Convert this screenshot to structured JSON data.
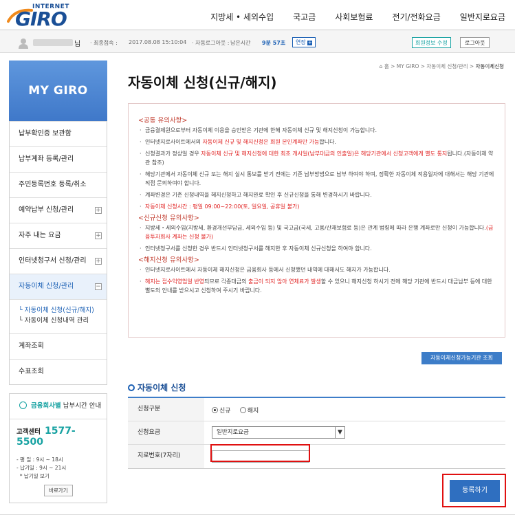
{
  "header": {
    "logo_small": "INTERNET",
    "logo_big": "GIRO",
    "nav": [
      "지방세 • 세외수입",
      "국고금",
      "사회보험료",
      "전기/전화요금",
      "일반지로요금"
    ]
  },
  "userbar": {
    "name_suffix": "님",
    "last_login_label": "· 최종접속 :",
    "last_login_value": "2017.08.08 15:10:04",
    "auto_logout_label": "· 자동로그아웃 :",
    "remaining_label": "남은시간",
    "remaining_value": "9분 57초",
    "extend_label": "연장",
    "edit_info_label": "회원정보 수정",
    "logout_label": "로그아웃"
  },
  "sidebar": {
    "title": "MY GIRO",
    "items": [
      {
        "label": "납부확인증 보관함",
        "plus": false
      },
      {
        "label": "납부계좌 등록/관리",
        "plus": false
      },
      {
        "label": "주민등록번호 등록/취소",
        "plus": false
      },
      {
        "label": "예약납부 신청/관리",
        "plus": true
      },
      {
        "label": "자주 내는 요금",
        "plus": true
      },
      {
        "label": "인터넷청구서 신청/관리",
        "plus": true
      },
      {
        "label": "자동이체 신청/관리",
        "plus": true,
        "active": true
      }
    ],
    "submenu": [
      "└ 자동이체 신청(신규/해지)",
      "└ 자동이체 신청내역 관리"
    ],
    "items_after": [
      "계좌조회",
      "수표조회"
    ],
    "help": {
      "top_teal": "금융회사별",
      "top_rest": "납부시간 안내",
      "center_label": "고객센터",
      "phone": "1577-5500",
      "hours": [
        "- 평   일 : 9시 ~ 18시",
        "- 납기일 : 9시 ~ 21시",
        "  * 납기일 보기"
      ],
      "shortcut_label": "바로가기"
    }
  },
  "breadcrumb": {
    "home": "홈",
    "path": "> MY GIRO > 자동이체 신청/관리 >",
    "current": "자동이체신청"
  },
  "page_title": "자동이체 신청(신규/해지)",
  "notice": {
    "sections": [
      {
        "heading": "<공통 유의사항>",
        "lines": [
          [
            {
              "t": "금융결제원으로부터 자동이체 이용을 승인받은 기관에 한해 자동이체 신규 및 해지신청이 가능합니다."
            }
          ],
          [
            {
              "t": "인터넷지로사이트에서의 "
            },
            {
              "t": "자동이체 신규 및 해지신청은 회원 본인계좌만 가능",
              "red": true
            },
            {
              "t": "합니다."
            }
          ],
          [
            {
              "t": "신청결과가 정상일 경우 "
            },
            {
              "t": "자동이체 신규 및 해지신청에 대한 최초 개시일(납부대금의 인출일)은 해당기관에서 신청고객에게 별도 통지",
              "red": true
            },
            {
              "t": "됩니다.(자동이체 약관 참조)"
            }
          ],
          [
            {
              "t": "해당기관에서 자동이체 신규 또는 해지 실시 통보를 받기 전에는 기존 납부방법으로 납부 하여야 하며, 정확한 자동이체 적용일자에 대해서는 해당 기관에 직접 문의하여야 합니다."
            }
          ],
          [
            {
              "t": "계좌변경은 기존 신청내역을 해지신청하고 해지완료 확인 후 신규신청을 통해 변경하시기 바랍니다."
            }
          ],
          [
            {
              "t": "자동이체 신청시간 : 평일 09:00~22:00(토, 일요일, 공휴일 불가)",
              "red": true
            }
          ]
        ]
      },
      {
        "heading": "<신규신청 유의사항>",
        "lines": [
          [
            {
              "t": "지방세・세외수입(지방세, 환경개선부담금, 세외수입 등) 및 국고금(국세, 고용/산재보험료 등)은 관계 법령에 따라 은행 계좌로만 신청이 가능합니다."
            },
            {
              "t": "(금융투자회사 계좌는 신청 불가)",
              "red": true
            }
          ],
          [
            {
              "t": "인터넷청구서를 신청한 경우 반드시 인터넷청구서를 해지한 후 자동이체 신규신청을 하여야 합니다."
            }
          ]
        ]
      },
      {
        "heading": "<해지신청 유의사항>",
        "lines": [
          [
            {
              "t": "인터넷지로사이트에서 자동이체 해지신청은 금융회사 등에서 신청했던 내역에 대해서도 해지가 가능합니다."
            }
          ],
          [
            {
              "t": "해지는 접수익영업일 반영",
              "red": true
            },
            {
              "t": "되므로 각종대금의 "
            },
            {
              "t": "출금이 되지 않아 연체료가 발생",
              "red": true
            },
            {
              "t": "할 수 있으니 해지신청 하시기 전에 해당 기관에 반드시 대금납부 등에 대한 별도의 안내를 받으시고 신청하여 주시기 바랍니다."
            }
          ]
        ]
      }
    ]
  },
  "institution_button": "자동이체신청가능기관 조회",
  "form": {
    "title": "자동이체 신청",
    "type_label": "신청구분",
    "type_options": [
      "신규",
      "해지"
    ],
    "type_selected": "신규",
    "fee_label": "신청요금",
    "fee_value": "일반지로요금",
    "giro_label": "지로번호(7자리)",
    "giro_value": "",
    "submit_label": "등록하기"
  }
}
